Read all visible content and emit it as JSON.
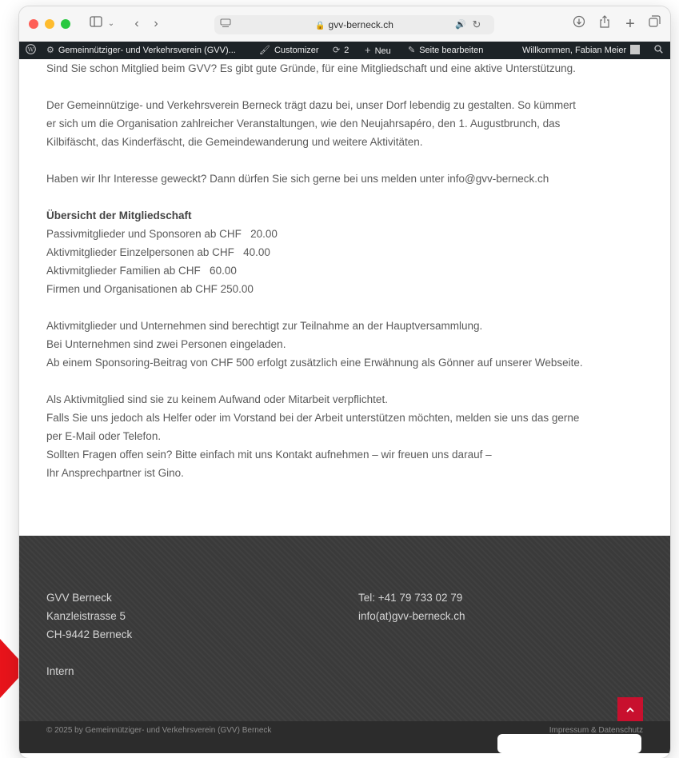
{
  "browser": {
    "url": "gvv-berneck.ch",
    "icons": {
      "sidebar": "sidebar-icon",
      "back": "chevron-left-icon",
      "forward": "chevron-right-icon",
      "download": "download-icon",
      "share": "share-icon",
      "new_tab": "plus-icon",
      "tabs": "tabs-icon",
      "audio": "speaker-icon",
      "reload": "reload-icon"
    }
  },
  "adminbar": {
    "site": "Gemeinnütziger- und Verkehrsverein (GVV)...",
    "customizer": "Customizer",
    "updates": "2",
    "new": "Neu",
    "edit": "Seite bearbeiten",
    "welcome": "Willkommen, Fabian Meier"
  },
  "content": {
    "intro": "Sind Sie schon Mitglied beim GVV? Es gibt gute Gründe, für eine Mitgliedschaft und eine aktive Unterstützung.",
    "p1_l1": "Der Gemeinnützige- und Verkehrsverein Berneck trägt dazu bei, unser Dorf lebendig zu gestalten. So kümmert",
    "p1_l2": "er sich um die Organisation zahlreicher Veranstaltungen, wie den Neujahrsapéro, den 1. Augustbrunch, das",
    "p1_l3": "Kilbifäscht, das Kinderfäscht, die Gemeindewanderung und weitere Aktivitäten.",
    "p2": "Haben wir Ihr Interesse geweckt? Dann dürfen Sie sich gerne bei uns melden unter info@gvv-berneck.ch",
    "membership_title": "Übersicht der Mitgliedschaft",
    "membership": [
      "Passivmitglieder und Sponsoren ab CHF   20.00",
      "Aktivmitglieder Einzelpersonen ab CHF   40.00",
      "Aktivmitglieder Familien ab CHF   60.00",
      "Firmen und Organisationen ab CHF 250.00"
    ],
    "p3_l1": "Aktivmitglieder und Unternehmen sind berechtigt zur Teilnahme an der Hauptversammlung.",
    "p3_l2": "Bei Unternehmen sind zwei Personen eingeladen.",
    "p3_l3": "Ab einem Sponsoring-Beitrag von CHF 500 erfolgt zusätzlich eine Erwähnung als Gönner auf unserer Webseite.",
    "p4_l1": "Als Aktivmitglied sind sie zu keinem Aufwand oder Mitarbeit verpflichtet.",
    "p4_l2": "Falls Sie uns jedoch als Helfer oder im Vorstand bei der Arbeit unterstützen möchten, melden sie uns das gerne",
    "p4_l3": "per E-Mail oder Telefon.",
    "p4_l4": "Sollten Fragen offen sein? Bitte einfach mit uns Kontakt aufnehmen – wir freuen uns darauf –",
    "p4_l5": "Ihr Ansprechpartner ist Gino."
  },
  "footer": {
    "org": "GVV Berneck",
    "street": "Kanzleistrasse 5",
    "city": "CH-9442 Berneck",
    "intern": "Intern",
    "tel": "Tel: +41 79 733 02 79",
    "email": "info(at)gvv-berneck.ch",
    "copyright": "© 2025 by Gemeinnütziger- und Verkehrsverein (GVV) Berneck",
    "impressum": "Impressum & Datenschutz"
  },
  "colors": {
    "accent_red": "#c8102e",
    "adminbar_bg": "#1d2327",
    "footer_bg": "#3a3a3a"
  }
}
